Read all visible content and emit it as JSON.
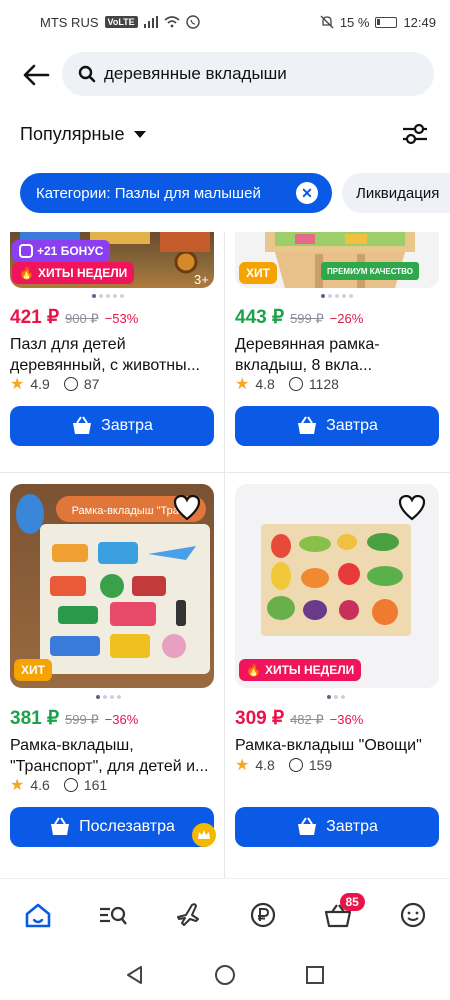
{
  "status_bar": {
    "carrier": "MTS RUS",
    "volte": "VoLTE",
    "battery": "15 %",
    "time": "12:49"
  },
  "search": {
    "query": "деревянные вкладыши"
  },
  "sort": {
    "label": "Популярные"
  },
  "chips": [
    {
      "label": "Категории: Пазлы для малышей"
    },
    {
      "label": "Ликвидация"
    }
  ],
  "products": [
    {
      "bonus": "+21 БОНУС",
      "badge": "ХИТЫ НЕДЕЛИ",
      "age": "3+",
      "price": "421 ₽",
      "old_price": "900 ₽",
      "discount": "−53%",
      "title": "Пазл для детей деревянный, с животны...",
      "rating": "4.9",
      "reviews": "87",
      "button": "Завтра"
    },
    {
      "badge": "ХИТ",
      "quality": "ПРЕМИУМ КАЧЕСТВО",
      "price": "443 ₽",
      "old_price": "599 ₽",
      "discount": "−26%",
      "title": "Деревянная рамка-вкладыш, 8 вкла...",
      "rating": "4.8",
      "reviews": "1128",
      "button": "Завтра"
    },
    {
      "badge": "ХИТ",
      "image_text": "Рамка-вкладыш \"Транс",
      "price": "381 ₽",
      "old_price": "599 ₽",
      "discount": "−36%",
      "title": "Рамка-вкладыш, \"Транспорт\", для детей и...",
      "rating": "4.6",
      "reviews": "161",
      "button": "Послезавтра"
    },
    {
      "badge": "ХИТЫ НЕДЕЛИ",
      "price": "309 ₽",
      "old_price": "482 ₽",
      "discount": "−36%",
      "title": "Рамка-вкладыш \"Овощи\"",
      "rating": "4.8",
      "reviews": "159",
      "button": "Завтра"
    }
  ],
  "bottom_nav": {
    "cart_count": "85"
  },
  "colors": {
    "accent": "#0a5ae6",
    "price_red": "#e8144a",
    "price_green": "#1aa34a",
    "badge_pink": "#f0145a",
    "badge_orange": "#f5a300",
    "badge_purple": "#8b3ff0"
  }
}
